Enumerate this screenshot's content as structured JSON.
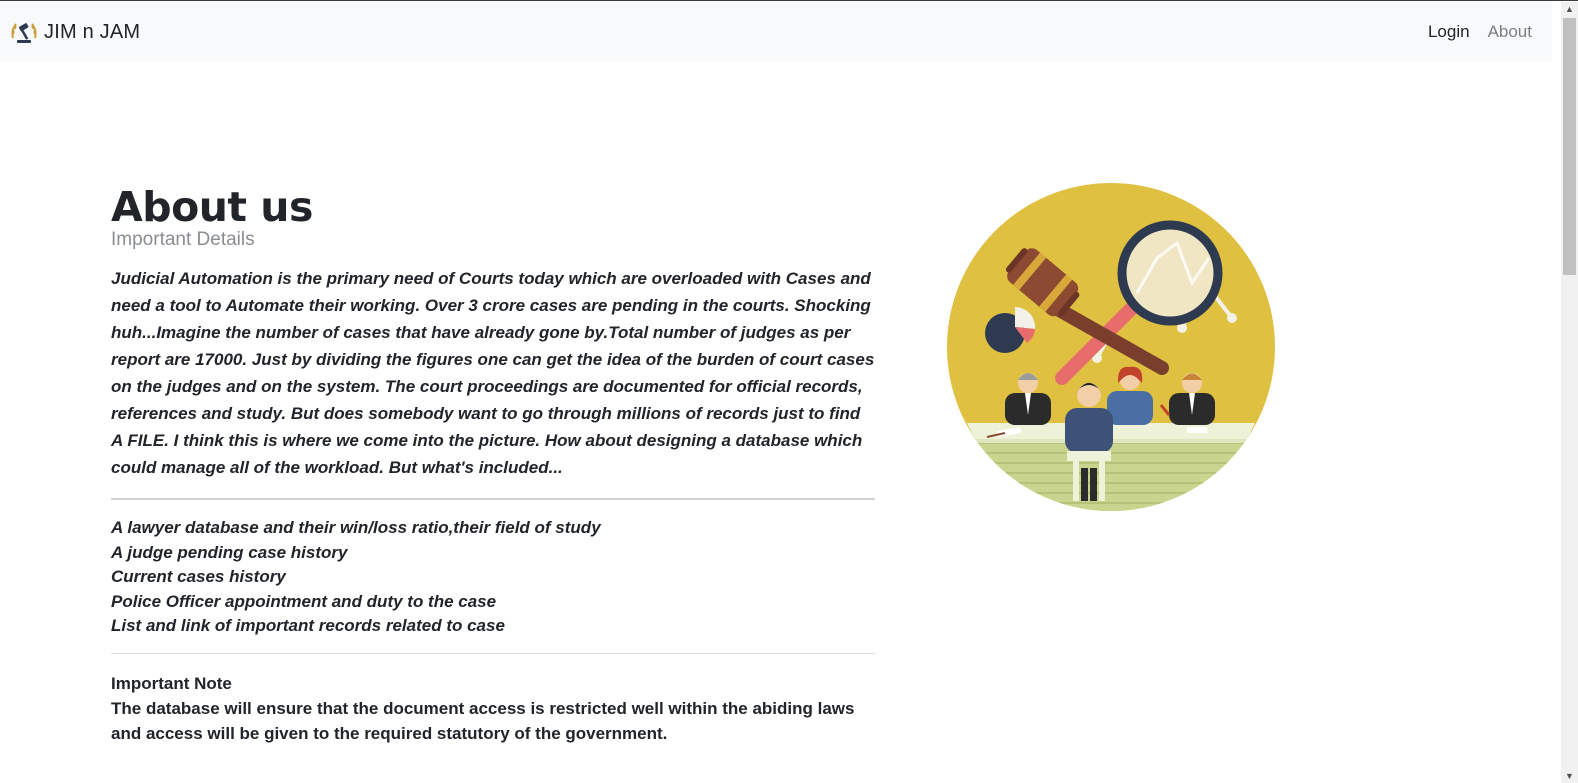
{
  "navbar": {
    "brand": "JIM n JAM",
    "logo_icon": "gavel-laurel-logo-icon",
    "links": [
      {
        "label": "Login",
        "color": "#212529"
      },
      {
        "label": "About",
        "color": "#7b7f84"
      }
    ]
  },
  "about": {
    "title": "About us",
    "subtitle": "Important Details",
    "intro": "Judicial Automation is the primary need of Courts today which are overloaded with Cases and need a tool to Automate their working. Over 3 crore cases are pending in the courts. Shocking huh...Imagine the number of cases that have already gone by.Total number of judges as per report are 17000. Just by dividing the figures one can get the idea of the burden of court cases on the judges and on the system. The court proceedings are documented for official records, references and study. But does somebody want to go through millions of records just to find A FILE. I think this is where we come into the picture. How about designing a database which could manage all of the workload. But what's included...",
    "features": [
      "A lawyer database and their win/loss ratio,their field of study",
      "A judge pending case history",
      "Current cases history",
      "Police Officer appointment and duty to the case",
      "List and link of important records related to case"
    ],
    "note_title": "Important Note",
    "note_text": "The database will ensure that the document access is restricted well within the abiding laws and access will be given to the required statutory of the government."
  },
  "illustration": {
    "icon": "courtroom-gavel-magnifier-illustration",
    "background_color": "#e0c040",
    "floor_color": "#c9d58f"
  }
}
